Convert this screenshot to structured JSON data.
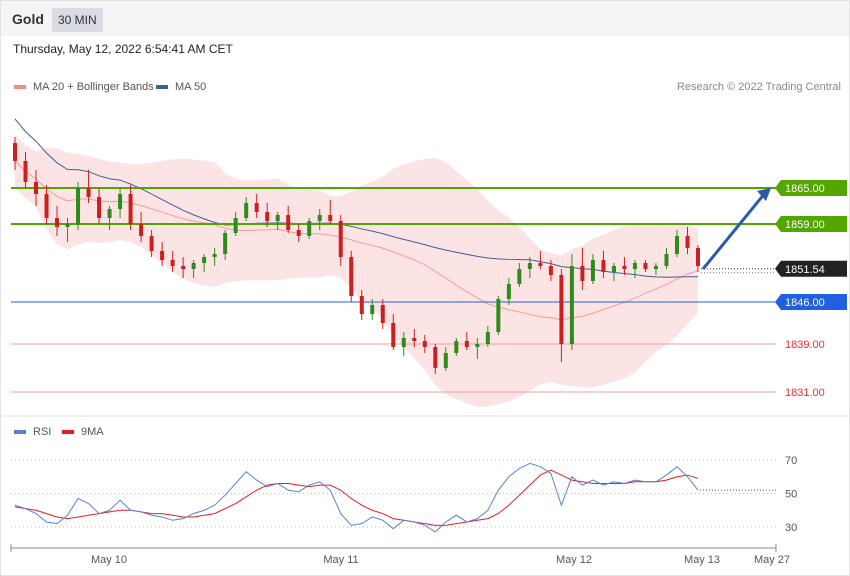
{
  "header": {
    "symbol": "Gold",
    "timeframe": "30 MIN"
  },
  "datetime": "Thursday, May 12, 2022 6:54:41 AM CET",
  "legend": {
    "items": [
      {
        "label": "MA 20 + Bollinger Bands",
        "color": "#f28b82"
      },
      {
        "label": "MA 50",
        "color": "#3a5f9e"
      }
    ],
    "credit": "Research © 2022 Trading Central"
  },
  "rsi_legend": {
    "items": [
      {
        "label": "RSI",
        "color": "#5b7fd6"
      },
      {
        "label": "9MA",
        "color": "#e02020"
      }
    ]
  },
  "colors": {
    "up": "#2e8b1e",
    "down": "#cc1f1f",
    "green_level": "#52a600",
    "blue_level": "#1f5fe0",
    "red_level": "#f29c9c",
    "band": "#fde4e4"
  },
  "chart_data": [
    {
      "type": "candlestick",
      "title": "Gold",
      "timeframe": "30 MIN",
      "x_ticks": [
        "May 10",
        "May 11",
        "May 12",
        "May 13",
        "May 27"
      ],
      "ylim": [
        1828,
        1880
      ],
      "last_price": 1851.54,
      "levels": [
        {
          "value": 1865.0,
          "label": "1865.00",
          "kind": "resistance",
          "color": "#52a600"
        },
        {
          "value": 1859.0,
          "label": "1859.00",
          "kind": "resistance",
          "color": "#52a600"
        },
        {
          "value": 1846.0,
          "label": "1846.00",
          "kind": "pivot",
          "color": "#1f5fe0"
        },
        {
          "value": 1839.0,
          "label": "1839.00",
          "kind": "support",
          "color": "#f29c9c"
        },
        {
          "value": 1831.0,
          "label": "1831.00",
          "kind": "support",
          "color": "#f29c9c"
        }
      ],
      "candles": [
        [
          1872.5,
          1873.5,
          1868,
          1869.5
        ],
        [
          1869.5,
          1871,
          1865,
          1866
        ],
        [
          1866,
          1868,
          1862,
          1864
        ],
        [
          1864,
          1865.5,
          1859,
          1860
        ],
        [
          1860,
          1862,
          1857,
          1858.5
        ],
        [
          1858.5,
          1860,
          1856,
          1859
        ],
        [
          1859,
          1866,
          1858,
          1865
        ],
        [
          1865,
          1868,
          1862.5,
          1863.5
        ],
        [
          1863.5,
          1865,
          1859,
          1860
        ],
        [
          1860,
          1862,
          1858,
          1861.5
        ],
        [
          1861.5,
          1865,
          1860,
          1864
        ],
        [
          1864,
          1865.5,
          1858,
          1859
        ],
        [
          1859,
          1861,
          1856,
          1857
        ],
        [
          1857,
          1858,
          1853.5,
          1854.5
        ],
        [
          1854.5,
          1856,
          1852,
          1853
        ],
        [
          1853,
          1854.5,
          1851,
          1852
        ],
        [
          1852,
          1853.5,
          1850,
          1851.5
        ],
        [
          1851.5,
          1853,
          1850,
          1852.5
        ],
        [
          1852.5,
          1854,
          1851,
          1853.5
        ],
        [
          1853.5,
          1855,
          1852,
          1854
        ],
        [
          1854,
          1858,
          1853,
          1857.5
        ],
        [
          1857.5,
          1861,
          1857,
          1860
        ],
        [
          1860,
          1863.5,
          1859.5,
          1862.5
        ],
        [
          1862.5,
          1864,
          1860,
          1861
        ],
        [
          1861,
          1862.5,
          1858.5,
          1859.5
        ],
        [
          1859.5,
          1861,
          1858,
          1860.5
        ],
        [
          1860.5,
          1862,
          1857.5,
          1858
        ],
        [
          1858,
          1859,
          1856,
          1857
        ],
        [
          1857,
          1860,
          1856.5,
          1859.5
        ],
        [
          1859.5,
          1861.5,
          1858,
          1860.5
        ],
        [
          1860.5,
          1863,
          1859,
          1859.5
        ],
        [
          1859.5,
          1860.5,
          1852,
          1853.5
        ],
        [
          1853.5,
          1854.5,
          1846,
          1847
        ],
        [
          1847,
          1848,
          1843,
          1844
        ],
        [
          1844,
          1846.5,
          1843,
          1845.5
        ],
        [
          1845.5,
          1846.5,
          1841.5,
          1842.5
        ],
        [
          1842.5,
          1844,
          1838,
          1838.5
        ],
        [
          1838.5,
          1841,
          1837,
          1840
        ],
        [
          1840,
          1841.5,
          1838.5,
          1839.5
        ],
        [
          1839.5,
          1840.5,
          1837.5,
          1838.5
        ],
        [
          1838.5,
          1839,
          1834,
          1835
        ],
        [
          1835,
          1838.5,
          1834.5,
          1837.5
        ],
        [
          1837.5,
          1840,
          1837,
          1839.5
        ],
        [
          1839.5,
          1841,
          1838,
          1838.5
        ],
        [
          1838.5,
          1840,
          1836.5,
          1839
        ],
        [
          1839,
          1842,
          1838.5,
          1841
        ],
        [
          1841,
          1847,
          1840.5,
          1846.5
        ],
        [
          1846.5,
          1850,
          1845.5,
          1849
        ],
        [
          1849,
          1852.5,
          1848.5,
          1851.5
        ],
        [
          1851.5,
          1853.5,
          1850,
          1852.5
        ],
        [
          1852.5,
          1854.5,
          1851.5,
          1852
        ],
        [
          1852,
          1853,
          1849.5,
          1850.5
        ],
        [
          1850.5,
          1851.5,
          1836,
          1839
        ],
        [
          1839,
          1854,
          1838,
          1852
        ],
        [
          1852,
          1855,
          1848,
          1849.5
        ],
        [
          1849.5,
          1854,
          1849,
          1853
        ],
        [
          1853,
          1854.5,
          1850,
          1851
        ],
        [
          1851,
          1852.5,
          1849.5,
          1852
        ],
        [
          1852,
          1853.5,
          1850.5,
          1851.5
        ],
        [
          1851.5,
          1853,
          1850,
          1852.5
        ],
        [
          1852.5,
          1853,
          1851,
          1851.5
        ],
        [
          1851.5,
          1852.5,
          1850.5,
          1852
        ],
        [
          1852,
          1855,
          1851.5,
          1854
        ],
        [
          1854,
          1858,
          1853.5,
          1857
        ],
        [
          1857,
          1858.5,
          1854,
          1855
        ],
        [
          1855,
          1855.5,
          1851,
          1852
        ]
      ],
      "series": [
        {
          "name": "MA 20 + Bollinger Bands",
          "type": "ma_bands"
        },
        {
          "name": "MA 50",
          "type": "ma"
        }
      ],
      "projection": {
        "from": 1851.5,
        "to": 1865.0
      }
    },
    {
      "type": "line",
      "title": "RSI",
      "ylim": [
        20,
        80
      ],
      "y_ticks": [
        30,
        50,
        70
      ],
      "series": [
        {
          "name": "RSI",
          "values": [
            43,
            41,
            38,
            33,
            32,
            37,
            47,
            44,
            38,
            40,
            46,
            40,
            39,
            37,
            36,
            34,
            35,
            38,
            40,
            43,
            49,
            56,
            63,
            58,
            54,
            56,
            52,
            51,
            55,
            57,
            52,
            38,
            31,
            32,
            36,
            34,
            29,
            34,
            33,
            31,
            27,
            33,
            37,
            33,
            35,
            40,
            52,
            60,
            65,
            68,
            66,
            62,
            43,
            60,
            55,
            58,
            55,
            57,
            56,
            58,
            57,
            57,
            61,
            66,
            60,
            52
          ]
        },
        {
          "name": "9MA",
          "values": [
            42,
            41,
            40,
            38,
            36,
            35,
            36,
            37,
            38,
            39,
            40,
            40,
            39,
            38,
            38,
            37,
            36,
            36,
            37,
            38,
            41,
            44,
            48,
            52,
            55,
            56,
            56,
            55,
            54,
            55,
            55,
            52,
            47,
            43,
            40,
            38,
            35,
            34,
            33,
            32,
            31,
            31,
            32,
            33,
            34,
            35,
            38,
            43,
            49,
            55,
            61,
            64,
            61,
            58,
            57,
            56,
            56,
            56,
            56,
            57,
            57,
            57,
            58,
            60,
            61,
            59
          ]
        }
      ]
    }
  ],
  "price_tags": [
    {
      "label": "1865.00",
      "bg": "#52a600"
    },
    {
      "label": "1859.00",
      "bg": "#52a600"
    },
    {
      "label": "1851.54",
      "bg": "#222222"
    },
    {
      "label": "1846.00",
      "bg": "#1f5fe0"
    },
    {
      "label": "1839.00",
      "bg": "none",
      "color": "#e03030"
    },
    {
      "label": "1831.00",
      "bg": "none",
      "color": "#e03030"
    }
  ],
  "rsi_ticks": [
    "70",
    "50",
    "30"
  ]
}
